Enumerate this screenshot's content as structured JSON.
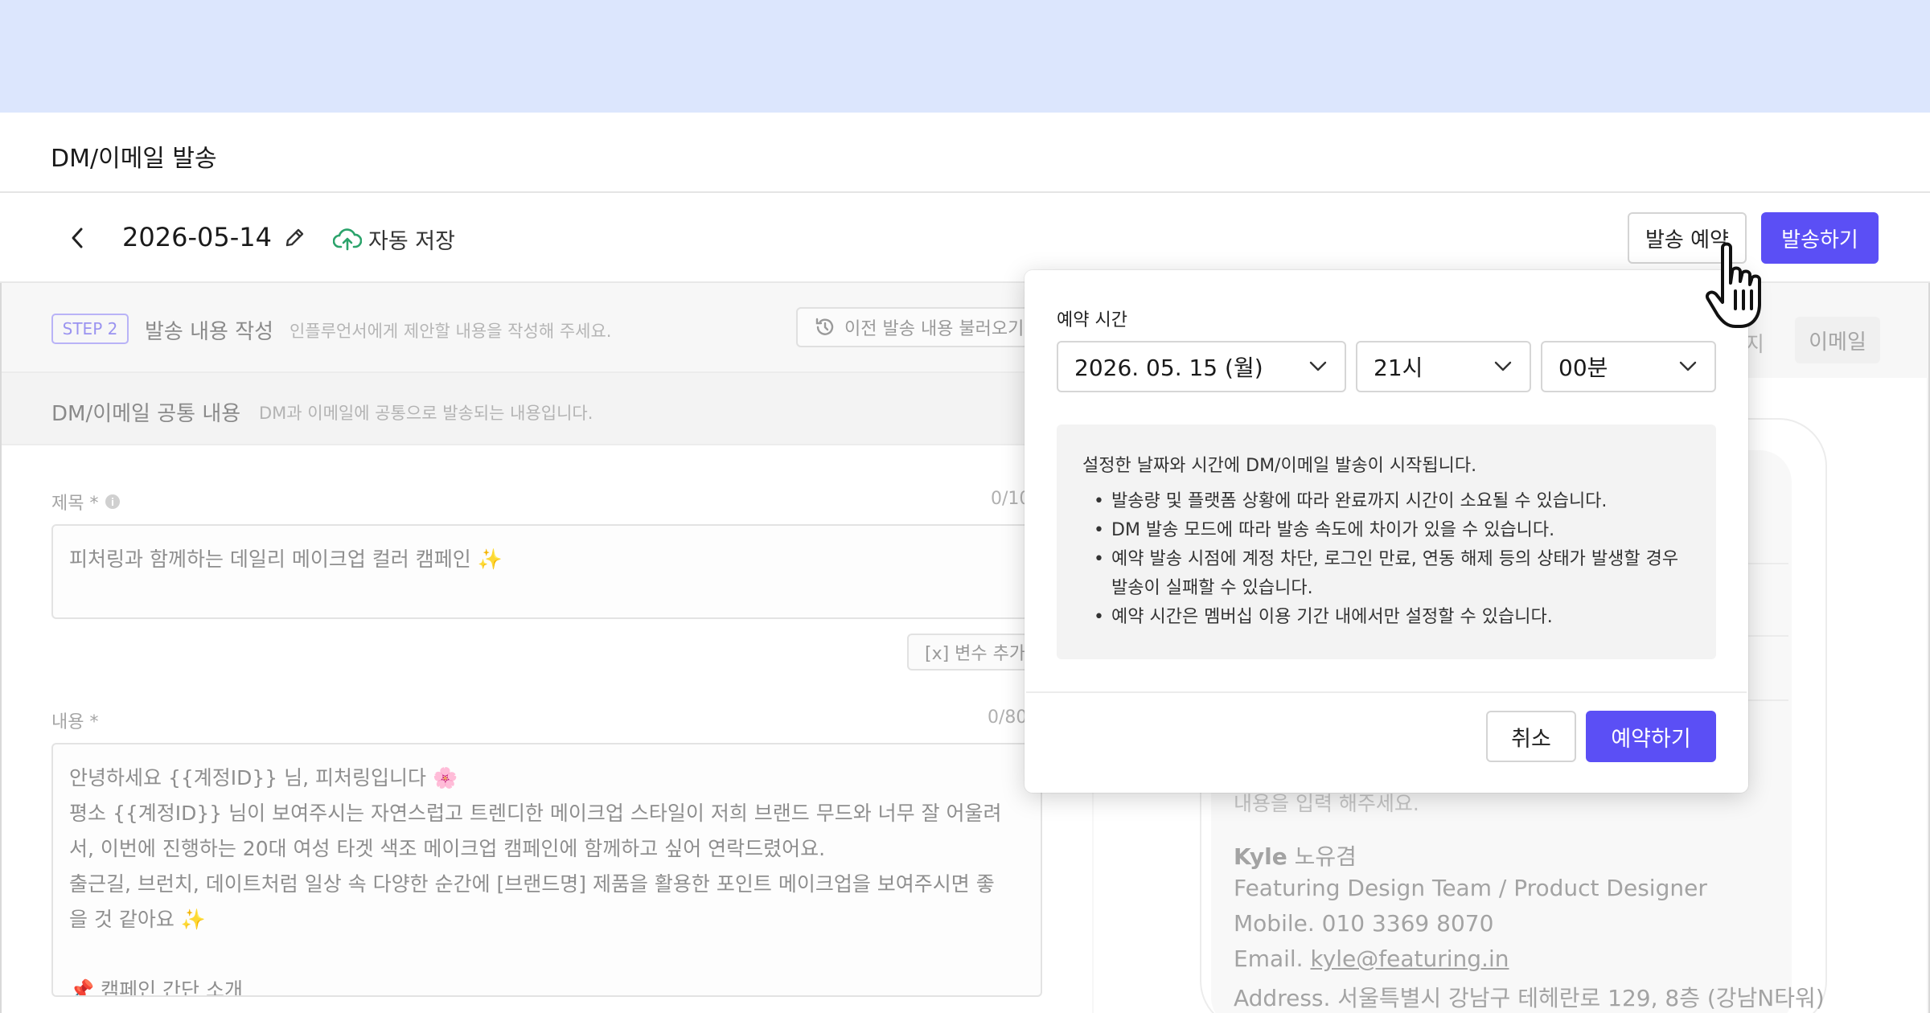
{
  "page": {
    "title": "DM/이메일 발송"
  },
  "toolbar": {
    "doc_title": "2026-05-14",
    "autosave_label": "자동 저장",
    "schedule_button": "발송 예약",
    "send_button": "발송하기"
  },
  "step": {
    "badge": "STEP 2",
    "title": "발송 내용 작성",
    "description": "인플루언서에게 제안할 내용을 작성해 주세요.",
    "history_button": "이전 발송 내용 불러오기"
  },
  "section": {
    "title": "DM/이메일 공통 내용",
    "description": "DM과 이메일에 공통으로 발송되는 내용입니다."
  },
  "subject": {
    "label": "제목 *",
    "counter": "0/10",
    "value": "피처링과 함께하는 데일리 메이크업 컬러 캠페인 ✨"
  },
  "variable_button": "[x] 변수 추가",
  "body": {
    "label": "내용 *",
    "counter": "0/80",
    "lines": [
      "안녕하세요 {{계정ID}} 님, 피처링입니다 🌸",
      "평소 {{계정ID}} 님이 보여주시는 자연스럽고 트렌디한 메이크업 스타일이 저희 브랜드 무드와 너무 잘 어울려",
      "서, 이번에 진행하는 20대 여성 타겟 색조 메이크업 캠페인에 함께하고 싶어 연락드렸어요.",
      "출근길, 브런치, 데이트처럼 일상 속 다양한 순간에 [브랜드명] 제품을 활용한 포인트 메이크업을 보여주시면 좋",
      "을 것 같아요 ✨",
      "",
      "📌 캠페인 간단 소개"
    ]
  },
  "preview": {
    "tab_email": "이메일",
    "tab_fragment": "지",
    "placeholder": "내용을 입력 해주세요.",
    "signature": {
      "name_bold": "Kyle",
      "name_rest": " 노유겸",
      "team": "Featuring Design Team / Product Designer",
      "mobile": "Mobile. 010 3369 8070",
      "email_prefix": "Email. ",
      "email": "kyle@featuring.in",
      "address": "Address. 서울특별시 강남구 테헤란로 129, 8층 (강남N타워)"
    }
  },
  "modal": {
    "label": "예약 시간",
    "date_value": "2026. 05. 15 (월)",
    "hour_value": "21시",
    "minute_value": "00분",
    "info_title": "설정한 날짜와 시간에 DM/이메일 발송이 시작됩니다.",
    "info_items": [
      "발송량 및 플랫폼 상황에 따라 완료까지 시간이 소요될 수 있습니다.",
      "DM 발송 모드에 따라 발송 속도에 차이가 있을 수 있습니다.",
      "예약 발송 시점에 계정 차단, 로그인 만료, 연동 해제 등의 상태가 발생할 경우 발송이 실패할 수 있습니다.",
      "예약 시간은 멤버십 이용 기간 내에서만 설정할 수 있습니다."
    ],
    "cancel_button": "취소",
    "confirm_button": "예약하기"
  },
  "colors": {
    "accent": "#5b4ff5",
    "top_band": "#dce6fd"
  }
}
